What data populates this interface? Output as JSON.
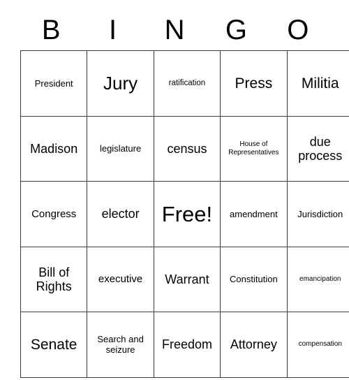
{
  "card": {
    "title": "BINGO",
    "header_letters": [
      "B",
      "I",
      "N",
      "G",
      "O"
    ],
    "border_color": "#3a3a3a",
    "text_color": "#000000",
    "background_color": "#ffffff",
    "columns": 5,
    "rows": 5,
    "cells": [
      [
        {
          "text": "President",
          "size": "md"
        },
        {
          "text": "Jury",
          "size": "3xl"
        },
        {
          "text": "ratification",
          "size": "sm"
        },
        {
          "text": "Press",
          "size": "2xl"
        },
        {
          "text": "Militia",
          "size": "2xl"
        }
      ],
      [
        {
          "text": "Madison",
          "size": "xl"
        },
        {
          "text": "legislature",
          "size": "md"
        },
        {
          "text": "census",
          "size": "xl"
        },
        {
          "text": "House of Representatives",
          "size": "xs"
        },
        {
          "text": "due process",
          "size": "xl"
        }
      ],
      [
        {
          "text": "Congress",
          "size": "lg"
        },
        {
          "text": "elector",
          "size": "xl"
        },
        {
          "text": "Free!",
          "size": "4xl"
        },
        {
          "text": "amendment",
          "size": "md"
        },
        {
          "text": "Jurisdiction",
          "size": "md"
        }
      ],
      [
        {
          "text": "Bill of Rights",
          "size": "xl"
        },
        {
          "text": "executive",
          "size": "lg"
        },
        {
          "text": "Warrant",
          "size": "xl"
        },
        {
          "text": "Constitution",
          "size": "md"
        },
        {
          "text": "emancipation",
          "size": "xs"
        }
      ],
      [
        {
          "text": "Senate",
          "size": "2xl"
        },
        {
          "text": "Search and seizure",
          "size": "md"
        },
        {
          "text": "Freedom",
          "size": "xl"
        },
        {
          "text": "Attorney",
          "size": "xl"
        },
        {
          "text": "compensation",
          "size": "xs"
        }
      ]
    ]
  }
}
